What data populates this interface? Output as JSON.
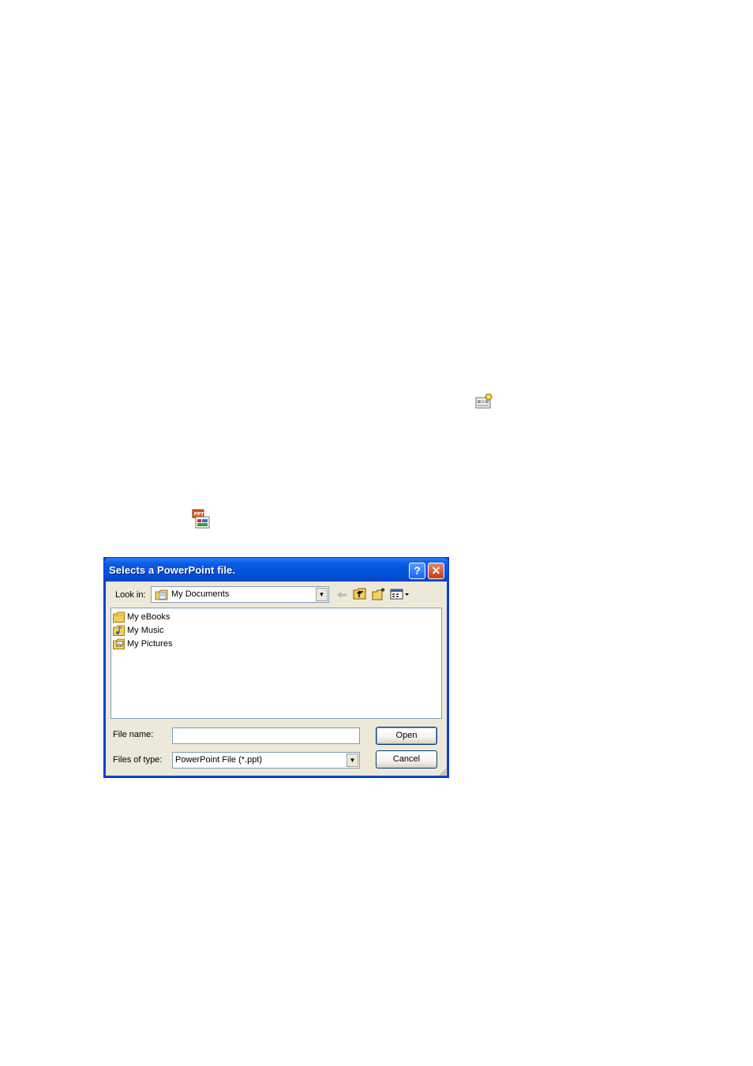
{
  "dialog": {
    "title": "Selects a PowerPoint file.",
    "help_label": "?",
    "close_label": "✕",
    "look_in_label": "Look in:",
    "look_in_value": "My Documents",
    "toolbar": {
      "back_icon": "back-arrow-icon",
      "up_icon": "up-folder-icon",
      "new_folder_icon": "new-folder-icon",
      "views_icon": "views-menu-icon"
    },
    "files": [
      {
        "name": "My eBooks",
        "icon": "folder-icon"
      },
      {
        "name": "My Music",
        "icon": "music-folder-icon"
      },
      {
        "name": "My Pictures",
        "icon": "pictures-folder-icon"
      }
    ],
    "file_name_label": "File name:",
    "file_name_value": "",
    "files_of_type_label": "Files of type:",
    "files_of_type_value": "PowerPoint File (*.ppt)",
    "open_label": "Open",
    "cancel_label": "Cancel"
  },
  "page_icons": {
    "settings_icon": "presentation-settings-icon",
    "ppt_icon": "ppt-file-icon"
  },
  "colors": {
    "titlebar": "#0652dd",
    "dialog_bg": "#ece9d8",
    "close_button": "#c83c16",
    "folder_yellow": "#f3cf5b"
  }
}
